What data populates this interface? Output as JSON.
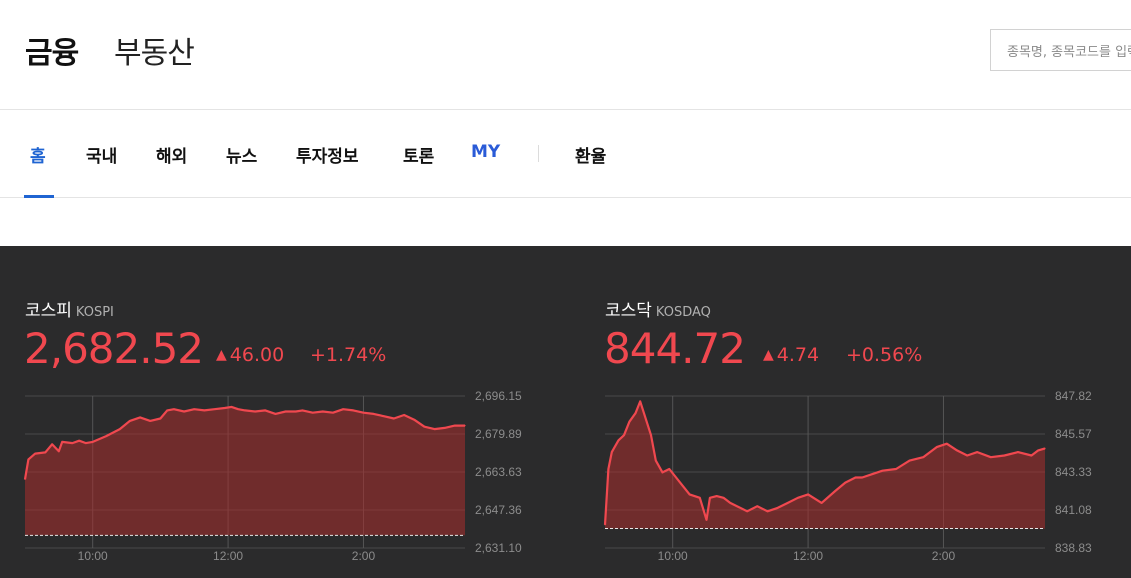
{
  "header": {
    "brand_finance": "금융",
    "brand_realestate": "부동산",
    "search_placeholder": "종목명, 종목코드를 입력하세요"
  },
  "nav": {
    "items": [
      "홈",
      "국내",
      "해외",
      "뉴스",
      "투자정보",
      "토론",
      "MY",
      "환율"
    ],
    "active": "홈"
  },
  "indices": [
    {
      "name": "코스피",
      "code": "KOSPI",
      "value": "2,682.52",
      "change": "46.00",
      "change_pct": "+1.74%",
      "direction": "up"
    },
    {
      "name": "코스닥",
      "code": "KOSDAQ",
      "value": "844.72",
      "change": "4.74",
      "change_pct": "+0.56%",
      "direction": "up"
    }
  ],
  "colors": {
    "up": "#f0484f",
    "accent": "#1f64d2",
    "dark_bg": "#2b2b2c"
  },
  "chart_data": [
    {
      "type": "area",
      "title": "코스피 KOSPI",
      "xticks": [
        "10:00",
        "12:00",
        "2:00"
      ],
      "yticks": [
        "2,696.15",
        "2,679.89",
        "2,663.63",
        "2,647.36",
        "2,631.10"
      ],
      "ylim": [
        2631.1,
        2696.15
      ],
      "xlim": [
        9.0,
        15.5
      ],
      "baseline": 2636.52,
      "x": [
        9.0,
        9.05,
        9.15,
        9.3,
        9.4,
        9.5,
        9.55,
        9.7,
        9.8,
        9.9,
        10.0,
        10.2,
        10.4,
        10.55,
        10.7,
        10.85,
        11.0,
        11.1,
        11.2,
        11.35,
        11.5,
        11.65,
        11.8,
        11.95,
        12.05,
        12.15,
        12.25,
        12.4,
        12.55,
        12.7,
        12.85,
        13.0,
        13.1,
        13.25,
        13.4,
        13.55,
        13.7,
        13.85,
        14.0,
        14.15,
        14.3,
        14.45,
        14.6,
        14.75,
        14.9,
        15.05,
        15.2,
        15.35,
        15.5
      ],
      "y": [
        2660.5,
        2669.0,
        2671.5,
        2672.0,
        2675.5,
        2672.5,
        2676.5,
        2676.0,
        2677.0,
        2676.0,
        2676.5,
        2679.0,
        2682.0,
        2685.5,
        2687.0,
        2685.5,
        2686.5,
        2690.0,
        2690.5,
        2689.5,
        2690.5,
        2690.0,
        2690.5,
        2691.0,
        2691.5,
        2690.5,
        2690.0,
        2689.5,
        2690.0,
        2688.5,
        2689.5,
        2689.5,
        2690.0,
        2689.0,
        2689.5,
        2689.0,
        2690.5,
        2690.0,
        2689.0,
        2688.5,
        2687.5,
        2686.5,
        2688.0,
        2686.0,
        2683.0,
        2682.0,
        2682.5,
        2683.5,
        2683.5
      ]
    },
    {
      "type": "area",
      "title": "코스닥 KOSDAQ",
      "xticks": [
        "10:00",
        "12:00",
        "2:00"
      ],
      "yticks": [
        "847.82",
        "845.57",
        "843.33",
        "841.08",
        "838.83"
      ],
      "ylim": [
        838.83,
        847.82
      ],
      "xlim": [
        9.0,
        15.5
      ],
      "baseline": 839.98,
      "x": [
        9.0,
        9.05,
        9.1,
        9.2,
        9.28,
        9.36,
        9.45,
        9.52,
        9.6,
        9.68,
        9.75,
        9.85,
        9.95,
        10.05,
        10.15,
        10.25,
        10.4,
        10.5,
        10.55,
        10.65,
        10.75,
        10.85,
        10.95,
        11.1,
        11.25,
        11.4,
        11.55,
        11.7,
        11.85,
        12.0,
        12.2,
        12.4,
        12.55,
        12.7,
        12.8,
        12.95,
        13.1,
        13.3,
        13.5,
        13.7,
        13.9,
        14.05,
        14.2,
        14.35,
        14.5,
        14.7,
        14.9,
        15.1,
        15.3,
        15.4,
        15.5
      ],
      "y": [
        840.2,
        843.5,
        844.5,
        845.2,
        845.5,
        846.3,
        846.8,
        847.5,
        846.5,
        845.5,
        844.0,
        843.3,
        843.5,
        843.0,
        842.5,
        842.0,
        841.8,
        840.5,
        841.8,
        841.9,
        841.8,
        841.5,
        841.3,
        841.0,
        841.3,
        841.0,
        841.2,
        841.5,
        841.8,
        842.0,
        841.5,
        842.2,
        842.7,
        843.0,
        843.0,
        843.2,
        843.4,
        843.5,
        844.0,
        844.2,
        844.8,
        845.0,
        844.6,
        844.3,
        844.5,
        844.2,
        844.3,
        844.5,
        844.3,
        844.6,
        844.72
      ]
    }
  ]
}
